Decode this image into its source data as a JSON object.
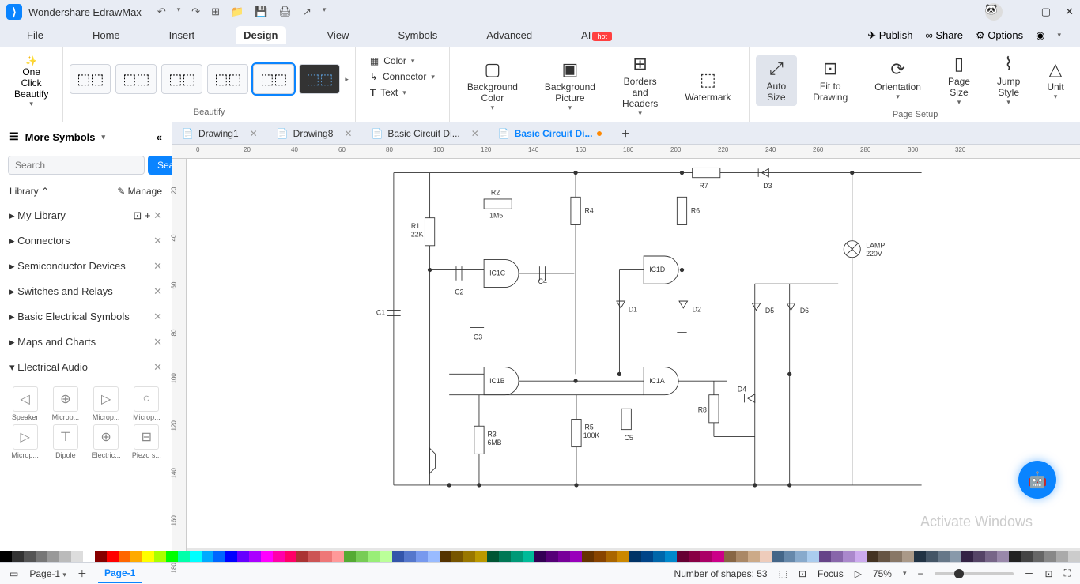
{
  "app_title": "Wondershare EdrawMax",
  "menus": [
    "File",
    "Home",
    "Insert",
    "Design",
    "View",
    "Symbols",
    "Advanced",
    "AI"
  ],
  "active_menu": "Design",
  "menu_right": {
    "publish": "Publish",
    "share": "Share",
    "options": "Options"
  },
  "ribbon": {
    "one_click": "One Click\nBeautify",
    "beautify_label": "Beautify",
    "color": "Color",
    "connector": "Connector",
    "text": "Text",
    "bg_color": "Background\nColor",
    "bg_pic": "Background\nPicture",
    "borders": "Borders and\nHeaders",
    "watermark": "Watermark",
    "background_label": "Background",
    "auto_size": "Auto\nSize",
    "fit": "Fit to\nDrawing",
    "orientation": "Orientation",
    "page_size": "Page\nSize",
    "jump": "Jump\nStyle",
    "unit": "Unit",
    "page_setup_label": "Page Setup"
  },
  "sidebar": {
    "title": "More Symbols",
    "search_placeholder": "Search",
    "search_btn": "Search",
    "library": "Library",
    "manage": "Manage",
    "my_library": "My Library",
    "cats": [
      "Connectors",
      "Semiconductor Devices",
      "Switches and Relays",
      "Basic Electrical Symbols",
      "Maps and Charts",
      "Electrical Audio"
    ],
    "symbols_row1": [
      "Speaker",
      "Microp...",
      "Microp...",
      "Microp..."
    ],
    "symbols_row2": [
      "Microp...",
      "Dipole",
      "Electric...",
      "Piezo s..."
    ]
  },
  "tabs": [
    {
      "name": "Drawing1",
      "active": false
    },
    {
      "name": "Drawing8",
      "active": false
    },
    {
      "name": "Basic Circuit Di...",
      "active": false
    },
    {
      "name": "Basic Circuit Di...",
      "active": true,
      "modified": true
    }
  ],
  "ruler_h": [
    "0",
    "20",
    "40",
    "60",
    "80",
    "100",
    "120",
    "140",
    "160",
    "180",
    "200",
    "220",
    "240",
    "260",
    "280",
    "300",
    "320"
  ],
  "ruler_v": [
    "20",
    "40",
    "60",
    "80",
    "100",
    "120",
    "140",
    "160",
    "180"
  ],
  "circuit": {
    "R1": {
      "label": "R1",
      "sub": "22K"
    },
    "R2": {
      "label": "R2",
      "sub": "1M5"
    },
    "R3": {
      "label": "R3",
      "sub": "6MB"
    },
    "R4": {
      "label": "R4"
    },
    "R5": {
      "label": "R5",
      "sub": "100K"
    },
    "R6": {
      "label": "R6"
    },
    "R7": {
      "label": "R7"
    },
    "R8": {
      "label": "R8"
    },
    "C1": {
      "label": "C1"
    },
    "C2": {
      "label": "C2"
    },
    "C3": {
      "label": "C3"
    },
    "C4": {
      "label": "C4"
    },
    "C5": {
      "label": "C5"
    },
    "D1": {
      "label": "D1"
    },
    "D2": {
      "label": "D2"
    },
    "D3": {
      "label": "D3"
    },
    "D4": {
      "label": "D4"
    },
    "D5": {
      "label": "D5"
    },
    "D6": {
      "label": "D6"
    },
    "ICIA": {
      "label": "IC1A"
    },
    "ICIB": {
      "label": "IC1B"
    },
    "ICIC": {
      "label": "IC1C"
    },
    "ICID": {
      "label": "IC1D"
    },
    "LAMP": {
      "label": "LAMP",
      "sub": "220V"
    }
  },
  "status": {
    "page_dropdown": "Page-1",
    "page_tab": "Page-1",
    "shapes": "Number of shapes: 53",
    "focus": "Focus",
    "zoom": "75%"
  },
  "colors": [
    "#000",
    "#333",
    "#555",
    "#777",
    "#999",
    "#bbb",
    "#ddd",
    "#fff",
    "#800",
    "#f00",
    "#f60",
    "#fa0",
    "#ff0",
    "#af0",
    "#0f0",
    "#0fa",
    "#0ff",
    "#0af",
    "#06f",
    "#00f",
    "#60f",
    "#a0f",
    "#f0f",
    "#f0a",
    "#f06",
    "#a33",
    "#c55",
    "#e77",
    "#f99",
    "#5a3",
    "#7c5",
    "#9e7",
    "#bf9",
    "#35a",
    "#57c",
    "#79e",
    "#9bf",
    "#530",
    "#750",
    "#970",
    "#b90",
    "#053",
    "#075",
    "#097",
    "#0b9",
    "#305",
    "#507",
    "#709",
    "#90b",
    "#630",
    "#840",
    "#a60",
    "#c80",
    "#036",
    "#048",
    "#06a",
    "#08c",
    "#603",
    "#804",
    "#a06",
    "#c08",
    "#864",
    "#a86",
    "#ca8",
    "#ecb",
    "#468",
    "#68a",
    "#8ac",
    "#ace",
    "#648",
    "#86a",
    "#a8c",
    "#cae",
    "#432",
    "#654",
    "#876",
    "#a98",
    "#234",
    "#456",
    "#678",
    "#89a",
    "#324",
    "#546",
    "#768",
    "#98a",
    "#222",
    "#444",
    "#666",
    "#888",
    "#aaa",
    "#ccc"
  ],
  "watermark_text": "Activate Windows"
}
